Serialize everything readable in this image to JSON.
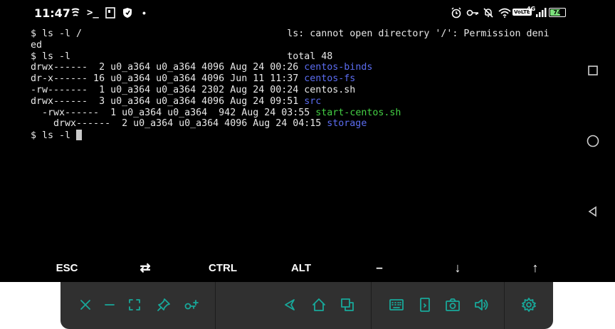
{
  "status_bar": {
    "time": "11:47",
    "volte": "VoLTE",
    "network": "4G",
    "battery": "74",
    "battery_level": 0.74
  },
  "terminal": {
    "lines": [
      {
        "segments": [
          {
            "text": "$ ls -l /                                    ls: cannot open directory '/': Permission deni"
          }
        ]
      },
      {
        "segments": [
          {
            "text": "ed"
          }
        ]
      },
      {
        "segments": [
          {
            "text": "$ ls -l                                      total 48"
          }
        ]
      },
      {
        "segments": [
          {
            "text": "drwx------  2 u0_a364 u0_a364 4096 Aug 24 00:26 "
          },
          {
            "text": "centos-binds",
            "color": "blue"
          }
        ]
      },
      {
        "segments": [
          {
            "text": "dr-x------ 16 u0_a364 u0_a364 4096 Jun 11 11:37 "
          },
          {
            "text": "centos-fs",
            "color": "blue"
          }
        ]
      },
      {
        "segments": [
          {
            "text": "-rw-------  1 u0_a364 u0_a364 2302 Aug 24 00:24 centos.sh"
          }
        ]
      },
      {
        "segments": [
          {
            "text": "drwx------  3 u0_a364 u0_a364 4096 Aug 24 09:51 "
          },
          {
            "text": "src",
            "color": "blue"
          }
        ]
      },
      {
        "segments": [
          {
            "text": "  -rwx------  1 u0_a364 u0_a364  942 Aug 24 03:55 "
          },
          {
            "text": "start-centos.sh",
            "color": "green"
          }
        ]
      },
      {
        "segments": [
          {
            "text": "    drwx------  2 u0_a364 u0_a364 4096 Aug 24 04:15 "
          },
          {
            "text": "storage",
            "color": "blue"
          }
        ]
      },
      {
        "segments": [
          {
            "text": "$ ls -l "
          }
        ],
        "cursor": true
      }
    ]
  },
  "extra_keys": {
    "esc": "ESC",
    "tab": "⇄",
    "ctrl": "CTRL",
    "alt": "ALT",
    "dash": "–",
    "down": "↓",
    "up": "↑"
  },
  "colors": {
    "terminal_bg": "#000000",
    "terminal_text": "#e8e8e8",
    "directory": "#5b6cf0",
    "executable": "#44d044",
    "toolbar_bg": "#303030",
    "toolbar_icon": "#18a89a"
  }
}
